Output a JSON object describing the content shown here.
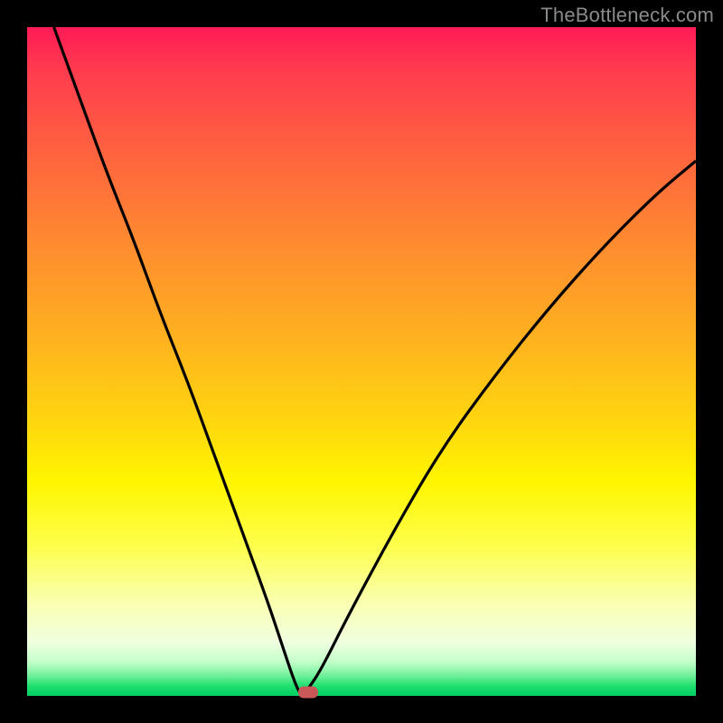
{
  "watermark": "TheBottleneck.com",
  "colors": {
    "frame": "#000000",
    "curve": "#000000",
    "marker": "#c95858",
    "gradient_top": "#ff1a55",
    "gradient_bottom": "#00d060"
  },
  "chart_data": {
    "type": "line",
    "title": "",
    "xlabel": "",
    "ylabel": "",
    "xlim": [
      0,
      100
    ],
    "ylim": [
      0,
      100
    ],
    "grid": false,
    "legend": false,
    "notes": "V-shaped bottleneck curve over red-to-green vertical gradient. Values are in percent of plot area (0=left/bottom, 100=right/top). Minimum occurs near x≈41 where y≈0.",
    "series": [
      {
        "name": "bottleneck-curve",
        "x": [
          4,
          8,
          12,
          16,
          20,
          24,
          28,
          32,
          36,
          38,
          40,
          41,
          42,
          44,
          48,
          55,
          62,
          70,
          78,
          86,
          94,
          100
        ],
        "y": [
          100,
          89,
          78,
          68,
          57,
          47,
          36,
          25,
          14,
          8,
          2,
          0,
          1,
          4,
          12,
          25,
          37,
          48,
          58,
          67,
          75,
          80
        ]
      }
    ],
    "marker": {
      "x": 42,
      "y": 0.5,
      "label": "optimal-point"
    },
    "gradient_stops": [
      {
        "pos": 0.0,
        "color": "#ff1a55"
      },
      {
        "pos": 0.18,
        "color": "#ff6040"
      },
      {
        "pos": 0.46,
        "color": "#ffb020"
      },
      {
        "pos": 0.68,
        "color": "#fff500"
      },
      {
        "pos": 0.92,
        "color": "#f0ffe0"
      },
      {
        "pos": 1.0,
        "color": "#00d060"
      }
    ]
  }
}
